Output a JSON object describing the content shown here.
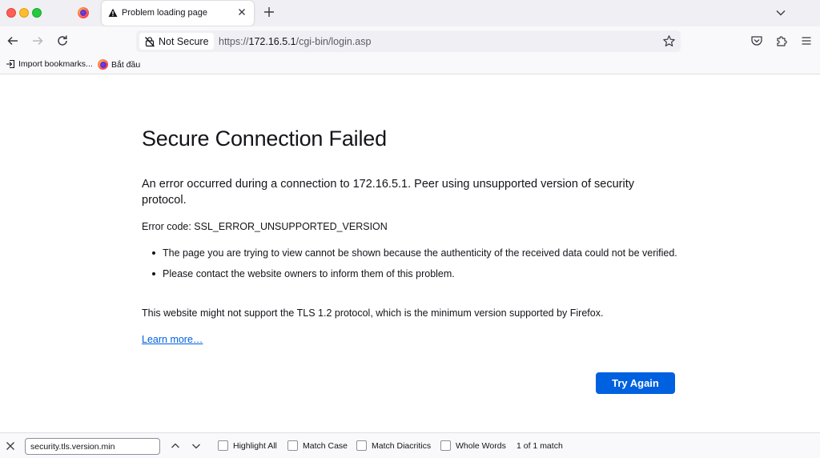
{
  "colors": {
    "accent": "#0061e0",
    "traffic_red": "#fe5f57",
    "traffic_yellow": "#febc2e",
    "traffic_green": "#28c840"
  },
  "tabs": {
    "active_title": "Problem loading page",
    "icons": {
      "pinned": "firefox-logo-icon",
      "active": "warning-triangle-icon",
      "close": "close-icon",
      "new_tab": "plus-icon",
      "list_all": "chevron-down-icon"
    }
  },
  "navbar": {
    "security_label": "Not Secure",
    "url_prefix": "https://",
    "url_host": "172.16.5.1",
    "url_path": "/cgi-bin/login.asp",
    "icons": [
      "back-arrow-icon",
      "forward-arrow-icon",
      "reload-icon",
      "lock-slash-icon",
      "star-icon",
      "pocket-icon",
      "extensions-icon",
      "menu-icon"
    ]
  },
  "bookmarks": {
    "items": [
      {
        "label": "Import bookmarks...",
        "icon": "import-icon"
      },
      {
        "label": "Bắt đầu",
        "icon": "firefox-logo-icon"
      }
    ]
  },
  "error": {
    "title": "Secure Connection Failed",
    "description": "An error occurred during a connection to 172.16.5.1. Peer using unsupported version of security protocol.",
    "code_line": "Error code: SSL_ERROR_UNSUPPORTED_VERSION",
    "bullets": [
      "The page you are trying to view cannot be shown because the authenticity of the received data could not be verified.",
      "Please contact the website owners to inform them of this problem."
    ],
    "tls_note": "This website might not support the TLS 1.2 protocol, which is the minimum version supported by Firefox.",
    "learn_more": "Learn more…",
    "try_again": "Try Again"
  },
  "findbar": {
    "query": "security.tls.version.min",
    "options": [
      "Highlight All",
      "Match Case",
      "Match Diacritics",
      "Whole Words"
    ],
    "status": "1 of 1 match",
    "icons": [
      "close-icon",
      "chevron-up-icon",
      "chevron-down-icon"
    ]
  }
}
